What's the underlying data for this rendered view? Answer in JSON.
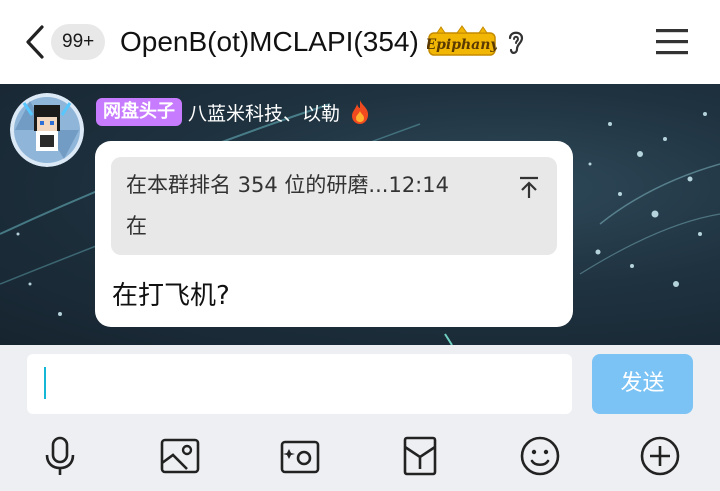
{
  "header": {
    "unread_count": "99+",
    "title": "OpenB(ot)MCLAPI(354)",
    "badge_text": "Epiphany"
  },
  "message": {
    "level_tag": "网盘头子",
    "sender": "八蓝米科技、以勒",
    "quote_header": "在本群排名 354 位的研磨...12:14",
    "quote_body": "在",
    "text": "在打飞机?"
  },
  "composer": {
    "input_value": "",
    "send_label": "发送"
  },
  "toolbar": {
    "icons": [
      "microphone-icon",
      "image-icon",
      "camera-icon",
      "red-packet-icon",
      "emoji-icon",
      "plus-icon"
    ]
  },
  "colors": {
    "send_button": "#7cc3f5",
    "level_tag": "#c77bff",
    "caret": "#14b8d6",
    "chat_background": "#1f3240"
  }
}
